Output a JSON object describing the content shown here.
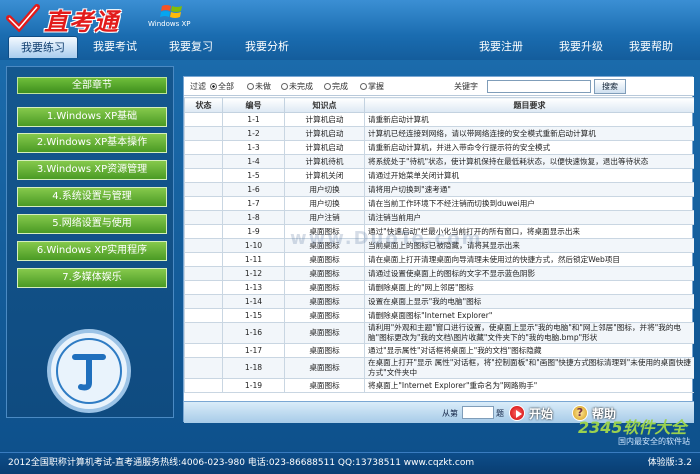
{
  "app": {
    "logo_text": "直考通",
    "os_label": "Windows XP"
  },
  "nav": {
    "items": [
      {
        "label": "我要练习"
      },
      {
        "label": "我要考试"
      },
      {
        "label": "我要复习"
      },
      {
        "label": "我要分析"
      },
      {
        "label": "我要注册"
      },
      {
        "label": "我要升级"
      },
      {
        "label": "我要帮助"
      }
    ]
  },
  "sidebar": {
    "title": "全部章节",
    "items": [
      {
        "label": "1.Windows XP基础"
      },
      {
        "label": "2.Windows XP基本操作"
      },
      {
        "label": "3.Windows XP资源管理"
      },
      {
        "label": "4.系统设置与管理"
      },
      {
        "label": "5.网络设置与使用"
      },
      {
        "label": "6.Windows XP实用程序"
      },
      {
        "label": "7.多媒体娱乐"
      }
    ]
  },
  "filter": {
    "label": "过滤",
    "options": [
      "全部",
      "未做",
      "未完成",
      "完成",
      "掌握"
    ],
    "keyword_label": "关键字",
    "search_label": "搜索"
  },
  "table": {
    "headers": [
      "状态",
      "编号",
      "知识点",
      "题目要求"
    ],
    "rows": [
      {
        "status": "",
        "id": "1-1",
        "topic": "计算机启动",
        "req": "请重新启动计算机"
      },
      {
        "status": "",
        "id": "1-2",
        "topic": "计算机启动",
        "req": "计算机已经连接到网络，请以带网络连接的安全模式重新启动计算机"
      },
      {
        "status": "",
        "id": "1-3",
        "topic": "计算机启动",
        "req": "请重新启动计算机，并进入带命令行提示符的安全模式"
      },
      {
        "status": "",
        "id": "1-4",
        "topic": "计算机待机",
        "req": "将系统处于\"待机\"状态，使计算机保持在最低耗状态，以便快速恢复，退出等待状态"
      },
      {
        "status": "",
        "id": "1-5",
        "topic": "计算机关闭",
        "req": "请通过开始菜单关闭计算机"
      },
      {
        "status": "",
        "id": "1-6",
        "topic": "用户切换",
        "req": "请将用户切换到\"速考通\""
      },
      {
        "status": "",
        "id": "1-7",
        "topic": "用户切换",
        "req": "请在当前工作环境下不经注销而切换到duwei用户"
      },
      {
        "status": "",
        "id": "1-8",
        "topic": "用户注销",
        "req": "请注销当前用户"
      },
      {
        "status": "",
        "id": "1-9",
        "topic": "桌面图标",
        "req": "通过\"快速启动\"栏最小化当前打开的所有窗口，将桌面显示出来"
      },
      {
        "status": "",
        "id": "1-10",
        "topic": "桌面图标",
        "req": "当前桌面上的图标已被隐藏，请将其显示出来"
      },
      {
        "status": "",
        "id": "1-11",
        "topic": "桌面图标",
        "req": "请在桌面上打开清理桌面向导清理未使用过的快捷方式，然后锁定Web项目"
      },
      {
        "status": "",
        "id": "1-12",
        "topic": "桌面图标",
        "req": "请通过设置使桌面上的图标的文字不显示蓝色阴影"
      },
      {
        "status": "",
        "id": "1-13",
        "topic": "桌面图标",
        "req": "请删除桌面上的\"网上邻居\"图标"
      },
      {
        "status": "",
        "id": "1-14",
        "topic": "桌面图标",
        "req": "设置在桌面上显示\"我的电脑\"图标"
      },
      {
        "status": "",
        "id": "1-15",
        "topic": "桌面图标",
        "req": "请删除桌面图标\"Internet Explorer\""
      },
      {
        "status": "",
        "id": "1-16",
        "topic": "桌面图标",
        "req": "请利用\"外观和主题\"窗口进行设置，使桌面上显示\"我的电脑\"和\"网上邻居\"图标，并将\"我的电脑\"图标更改为\"我的文档\\图片收藏\"文件夹下的\"我的电脑.bmp\"形状"
      },
      {
        "status": "",
        "id": "1-17",
        "topic": "桌面图标",
        "req": "通过\"显示属性\"对话框将桌面上\"我的文档\"图标隐藏"
      },
      {
        "status": "",
        "id": "1-18",
        "topic": "桌面图标",
        "req": "在桌面上打开\"显示 属性\"对话框，将\"控制面板\"和\"画图\"快捷方式图标清理到\"未使用的桌面快捷方式\"文件夹中"
      },
      {
        "status": "",
        "id": "1-19",
        "topic": "桌面图标",
        "req": "将桌面上\"Internet Explorer\"重命名为\"网路购手\""
      }
    ]
  },
  "bottom": {
    "from_label": "从第",
    "to_label": "题",
    "start_label": "开始",
    "help_label": "帮助"
  },
  "status": {
    "left": "2012全国职称计算机考试-直考通服务热线:4006-023-980  电话:023-86688511  QQ:13738511  www.cqzkt.com",
    "right": "体验版:3.2"
  },
  "watermarks": {
    "center": "www.DuoTe.com",
    "brand": "2345软件大全",
    "brand_sub": "国内最安全的软件站"
  }
}
